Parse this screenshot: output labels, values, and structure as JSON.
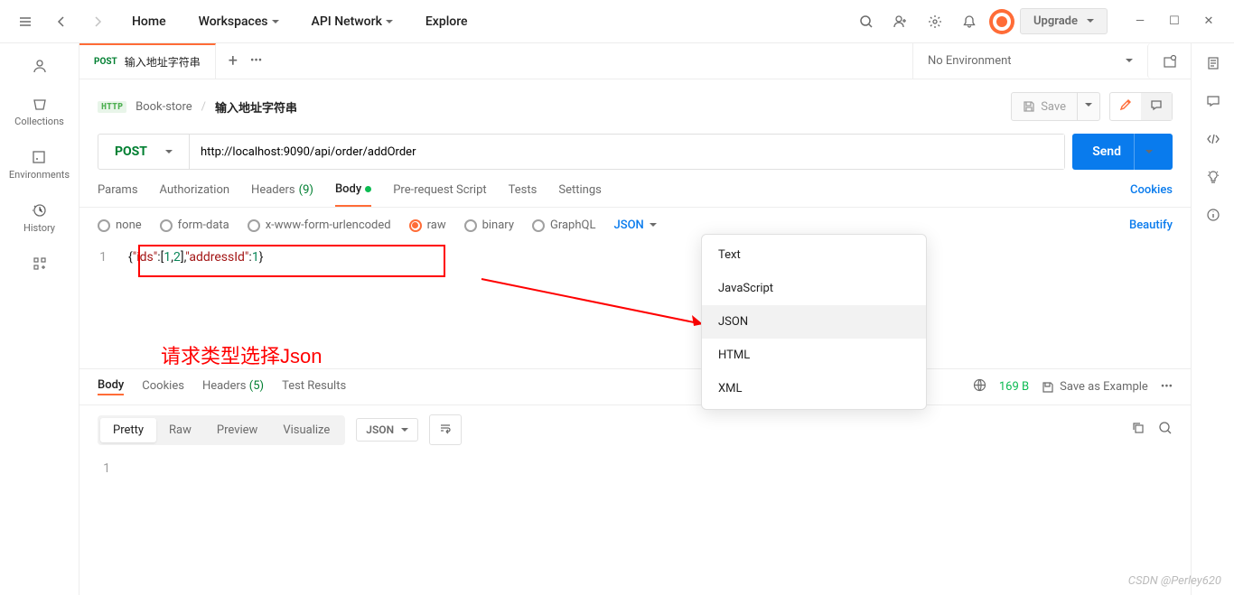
{
  "header": {
    "nav": {
      "home": "Home",
      "workspaces": "Workspaces",
      "api_network": "API Network",
      "explore": "Explore"
    },
    "upgrade": "Upgrade"
  },
  "left_rail": {
    "collections": "Collections",
    "environments": "Environments",
    "history": "History"
  },
  "tabs": {
    "method": "POST",
    "title": "输入地址字符串",
    "env": "No Environment"
  },
  "breadcrumb": {
    "http": "HTTP",
    "collection": "Book-store",
    "request": "输入地址字符串",
    "save": "Save"
  },
  "url": {
    "method": "POST",
    "value": "http://localhost:9090/api/order/addOrder",
    "send": "Send"
  },
  "req_tabs": {
    "params": "Params",
    "auth": "Authorization",
    "headers": "Headers",
    "headers_count": "(9)",
    "body": "Body",
    "prerequest": "Pre-request Script",
    "tests": "Tests",
    "settings": "Settings",
    "cookies": "Cookies"
  },
  "body_types": {
    "none": "none",
    "form_data": "form-data",
    "urlencoded": "x-www-form-urlencoded",
    "raw": "raw",
    "binary": "binary",
    "graphql": "GraphQL",
    "json": "JSON",
    "beautify": "Beautify"
  },
  "editor": {
    "lineno": "1",
    "code_raw": "{\"ids\":[1,2],\"addressId\":1}"
  },
  "annotation": {
    "text": "请求类型选择Json"
  },
  "dropdown": {
    "text": "Text",
    "javascript": "JavaScript",
    "json": "JSON",
    "html": "HTML",
    "xml": "XML"
  },
  "response": {
    "body": "Body",
    "cookies": "Cookies",
    "headers": "Headers",
    "headers_count": "(5)",
    "test_results": "Test Results",
    "size": "169 B",
    "save_example": "Save as Example",
    "views": {
      "pretty": "Pretty",
      "raw": "Raw",
      "preview": "Preview",
      "visualize": "Visualize",
      "json": "JSON"
    },
    "lineno": "1"
  },
  "watermark": "CSDN @Perley620"
}
